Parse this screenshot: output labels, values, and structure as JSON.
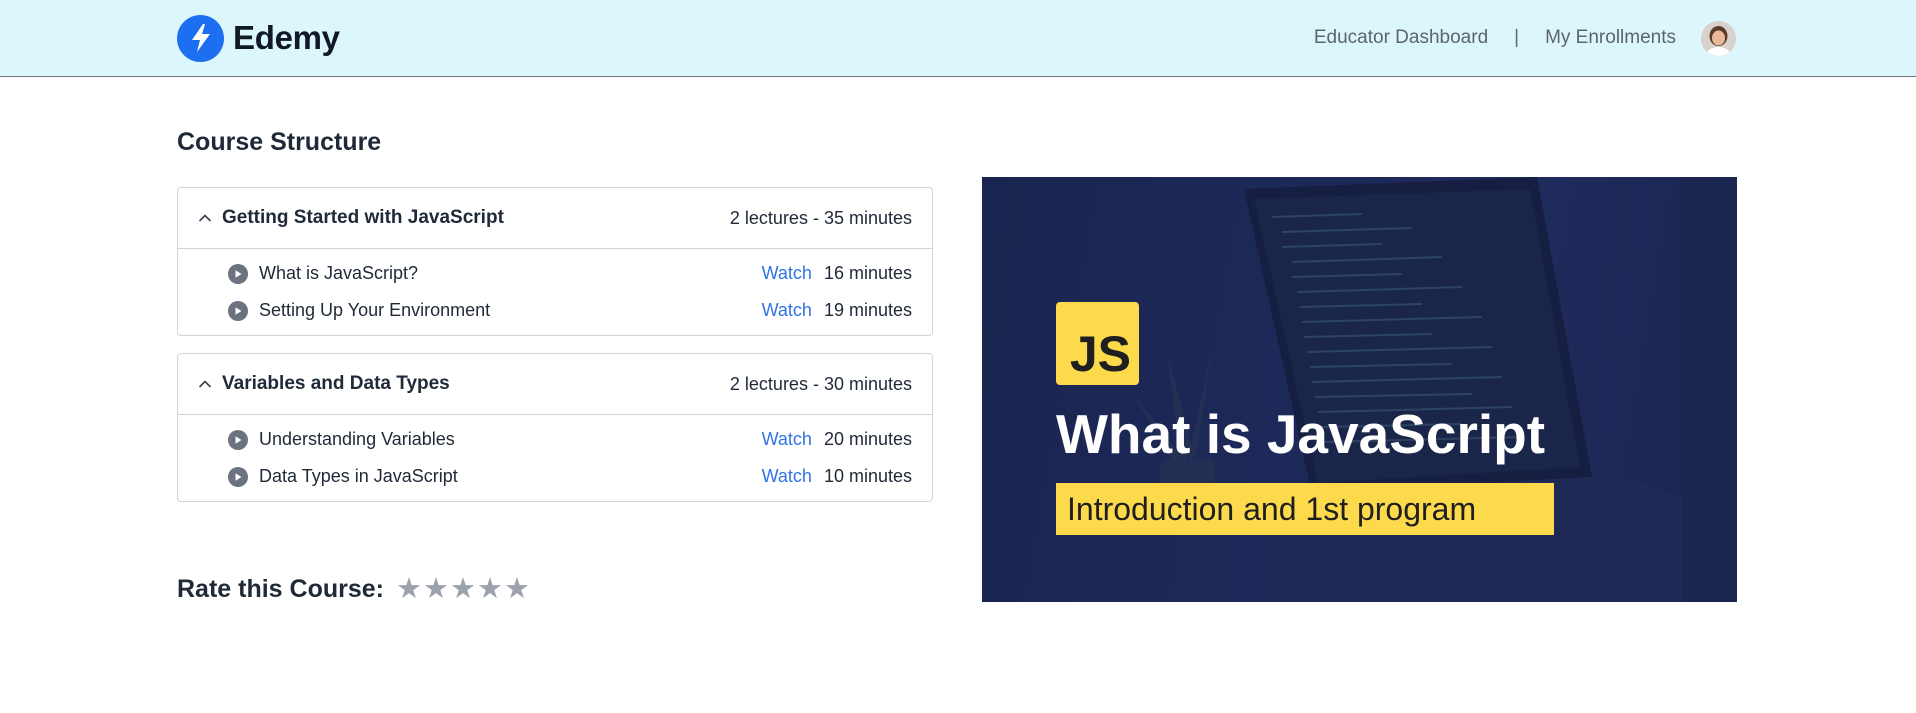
{
  "header": {
    "brand": "Edemy",
    "nav": {
      "educator": "Educator Dashboard",
      "separator": "|",
      "enrollments": "My Enrollments"
    }
  },
  "course": {
    "section_title": "Course Structure",
    "chapters": [
      {
        "title": "Getting Started with JavaScript",
        "meta": "2 lectures - 35 minutes",
        "lectures": [
          {
            "title": "What is JavaScript?",
            "action": "Watch",
            "duration": "16 minutes"
          },
          {
            "title": "Setting Up Your Environment",
            "action": "Watch",
            "duration": "19 minutes"
          }
        ]
      },
      {
        "title": "Variables and Data Types",
        "meta": "2 lectures - 30 minutes",
        "lectures": [
          {
            "title": "Understanding Variables",
            "action": "Watch",
            "duration": "20 minutes"
          },
          {
            "title": "Data Types in JavaScript",
            "action": "Watch",
            "duration": "10 minutes"
          }
        ]
      }
    ]
  },
  "rating": {
    "label": "Rate this Course:",
    "star_glyph": "★",
    "value": 0,
    "max": 5
  },
  "thumbnail": {
    "badge": "JS",
    "title": "What is JavaScript",
    "subtitle": "Introduction and 1st program"
  },
  "colors": {
    "header_bg": "#dcf7fc",
    "brand_blue": "#1d6ff2",
    "link_blue": "#2f74e6",
    "thumb_bg": "#1f2b5c",
    "js_yellow": "#fdd94c",
    "star_inactive": "#9ca3af"
  },
  "icons": {
    "logo": "lightning-bolt-icon",
    "chapter_toggle": "chevron-up-icon",
    "lecture": "play-circle-icon",
    "rating": "star-icon"
  }
}
